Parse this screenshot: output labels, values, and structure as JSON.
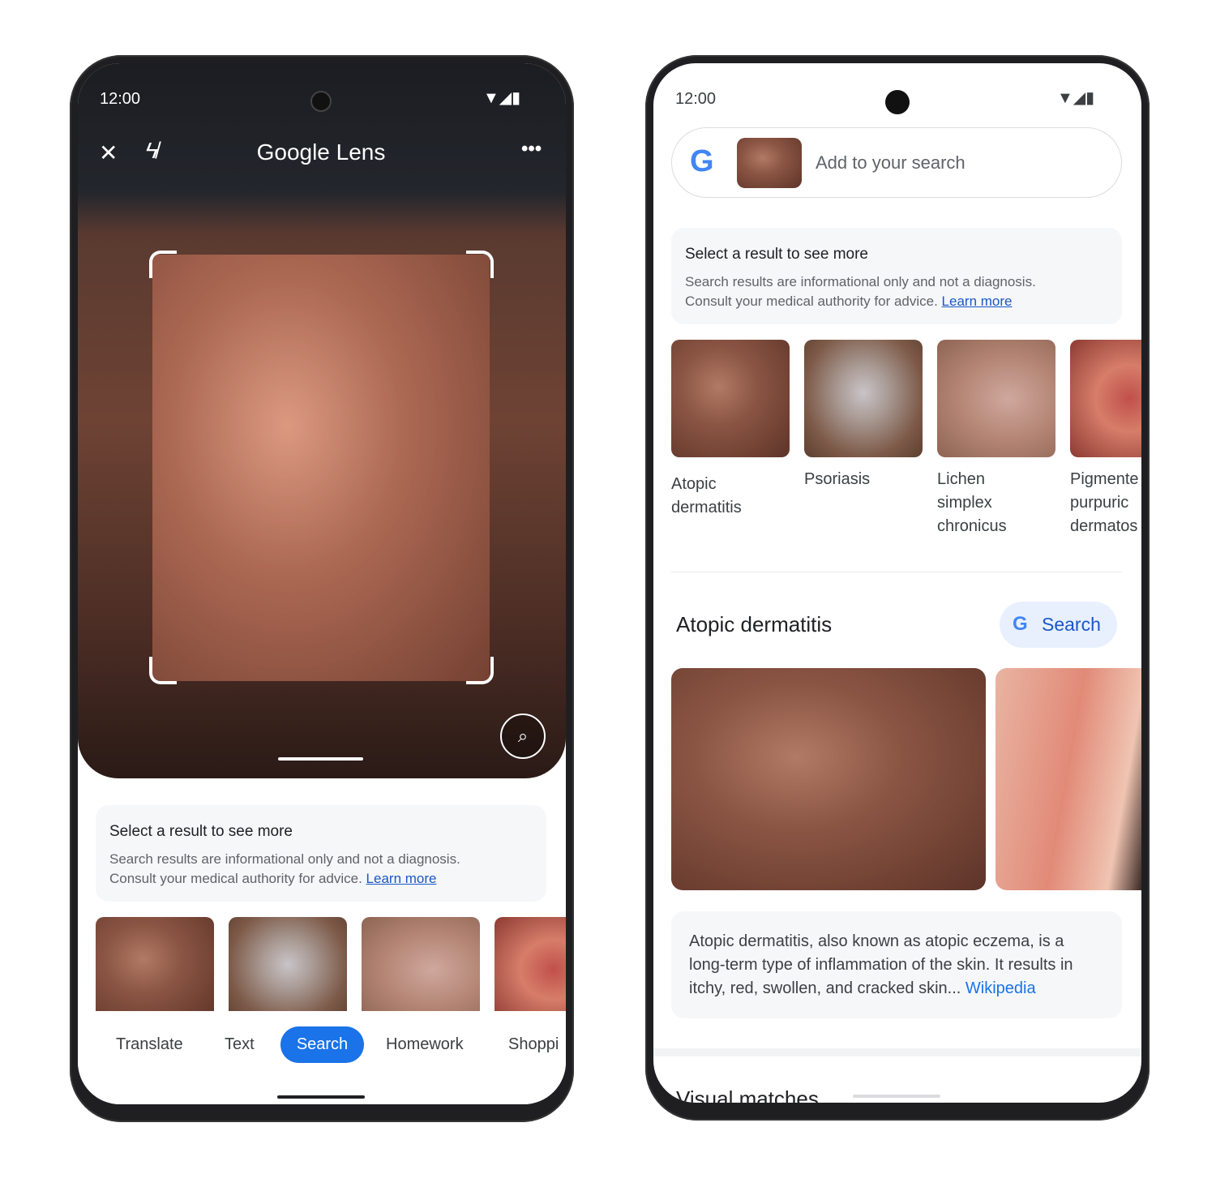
{
  "left_phone": {
    "status": {
      "time": "12:00"
    },
    "toolbar": {
      "title": "Google Lens"
    },
    "card": {
      "title": "Select a result to see more",
      "line1": "Search results are informational only and not a diagnosis.",
      "line2": "Consult your medical authority for advice.",
      "link": "Learn more"
    },
    "tabs": [
      {
        "label": "Translate"
      },
      {
        "label": "Text"
      },
      {
        "label": "Search",
        "selected": true
      },
      {
        "label": "Homework"
      },
      {
        "label": "Shoppi"
      }
    ]
  },
  "right_phone": {
    "status": {
      "time": "12:00"
    },
    "search": {
      "placeholder": "Add to your search"
    },
    "card": {
      "title": "Select a result to see more",
      "line1": "Search results are informational only and not a diagnosis.",
      "line2": "Consult your medical authority for advice.",
      "link": "Learn more"
    },
    "results": [
      {
        "line1": "Atopic",
        "line2": "dermatitis"
      },
      {
        "line1": "Psoriasis"
      },
      {
        "line1": "Lichen",
        "line2": "simplex",
        "line3": "chronicus"
      },
      {
        "line1": "Pigmente",
        "line2": "purpuric",
        "line3": "dermatos"
      }
    ],
    "section": {
      "title": "Atopic dermatitis",
      "search_label": "Search"
    },
    "description": {
      "line1": "Atopic dermatitis, also known as atopic eczema, is a",
      "line2": "long-term type of inflammation of the skin. It results in",
      "line3": "itchy, red, swollen, and cracked skin...",
      "link": "Wikipedia"
    },
    "visual_matches": "Visual matches"
  },
  "colors": {
    "accent": "#1a73e8",
    "chip_bg": "#e8f0fe",
    "card_bg": "#f6f7f9"
  }
}
